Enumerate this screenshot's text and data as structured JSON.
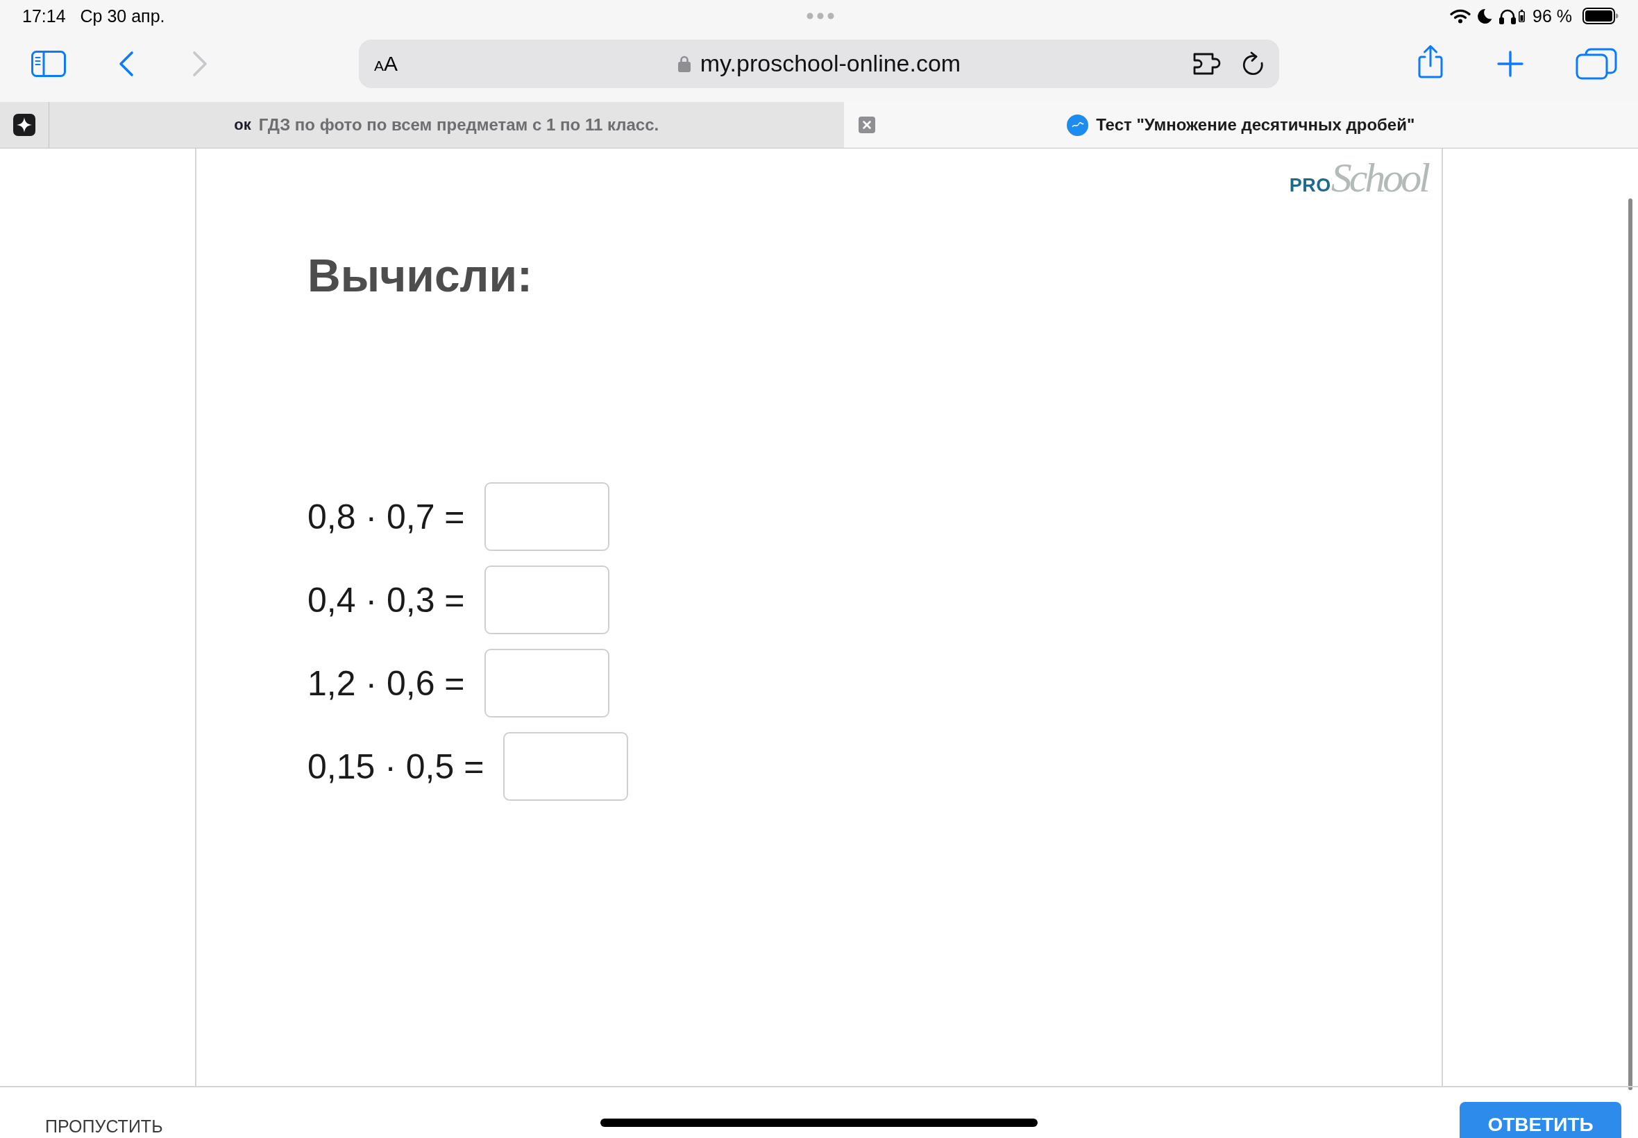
{
  "status_bar": {
    "time": "17:14",
    "date": "Ср 30 апр.",
    "battery_percent": "96 %"
  },
  "toolbar": {
    "nav_buttons": [
      {
        "kind": "back",
        "disabled": false
      },
      {
        "kind": "forward",
        "disabled": true
      }
    ],
    "address_bar": {
      "reader_label": "AA",
      "url": "my.proschool-online.com"
    }
  },
  "tabs": [
    {
      "favicon_text": "ок",
      "title": "ГДЗ по фото по всем предметам с 1 по 11 класс.",
      "selected": false
    },
    {
      "title": "Тест \"Умножение десятичных дробей\"",
      "selected": true
    }
  ],
  "logo": {
    "prefix": "PRO",
    "wordmark": "School"
  },
  "heading": "Вычисли:",
  "exercises": [
    {
      "expression": "0,8 · 0,7 ="
    },
    {
      "expression": "0,4 · 0,3 ="
    },
    {
      "expression": "1,2 · 0,6 ="
    },
    {
      "expression": "0,15 · 0,5 ="
    }
  ],
  "footer": {
    "skip_button": "ПРОПУСТИТЬ",
    "answer_button": "ОТВЕТИТЬ"
  }
}
